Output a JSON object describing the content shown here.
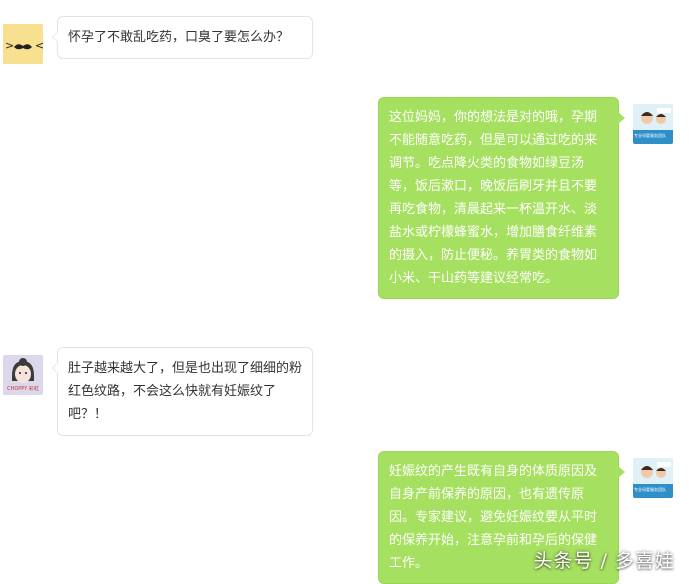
{
  "messages": [
    {
      "side": "left",
      "avatar": "mustache-avatar-icon",
      "text": "怀孕了不敢乱吃药，口臭了要怎么办？"
    },
    {
      "side": "right",
      "avatar": "doctor-avatar-icon",
      "avatar_caption": "专业母婴服务团队",
      "text": "这位妈妈，你的想法是对的哦，孕期不能随意吃药，但是可以通过吃的来调节。吃点降火类的食物如绿豆汤等，饭后漱口，晚饭后刷牙并且不要再吃食物，清晨起来一杯温开水、淡盐水或柠檬蜂蜜水，增加膳食纤维素的摄入，防止便秘。养胃类的食物如小米、干山药等建议经常吃。"
    },
    {
      "side": "left",
      "avatar": "girl-avatar-icon",
      "avatar_caption": "CHOPPY 彩虹",
      "text": "肚子越来越大了，但是也出现了细细的粉红色纹路，不会这么快就有妊娠纹了吧？！"
    },
    {
      "side": "right",
      "avatar": "doctor-avatar-icon",
      "avatar_caption": "专业母婴服务团队",
      "text": "妊娠纹的产生既有自身的体质原因及自身产前保养的原因，也有遗传原因。专家建议，避免妊娠纹要从平时的保养开始，注意孕前和孕后的保健工作。"
    }
  ],
  "watermark": "头条号 / 多喜娃",
  "colors": {
    "right_bubble": "#a6e060",
    "left_bubble": "#ffffff",
    "left_text": "#333333",
    "right_text": "#ffffff"
  }
}
